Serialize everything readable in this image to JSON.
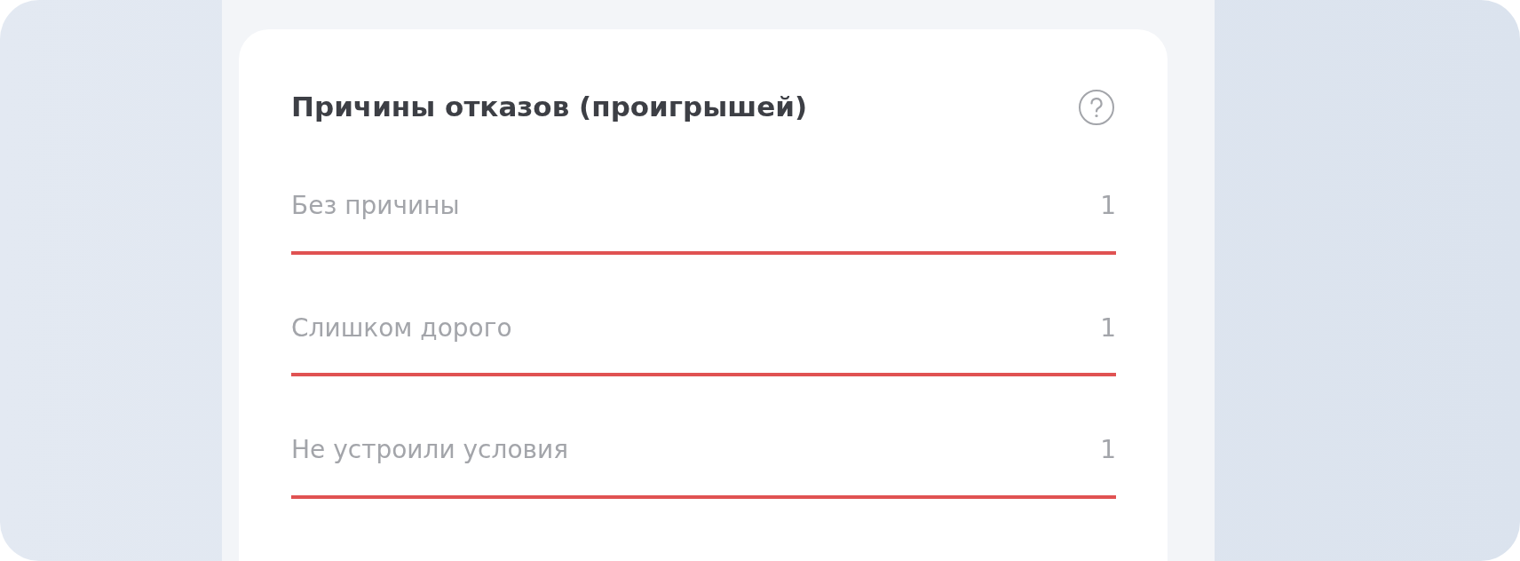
{
  "card": {
    "title": "Причины отказов (проигрышей)",
    "reasons": [
      {
        "label": "Без причины",
        "count": "1",
        "level": 1
      },
      {
        "label": "Слишком дорого",
        "count": "1",
        "level": 1
      },
      {
        "label": "Не устроили условия",
        "count": "1",
        "level": 1
      }
    ]
  }
}
